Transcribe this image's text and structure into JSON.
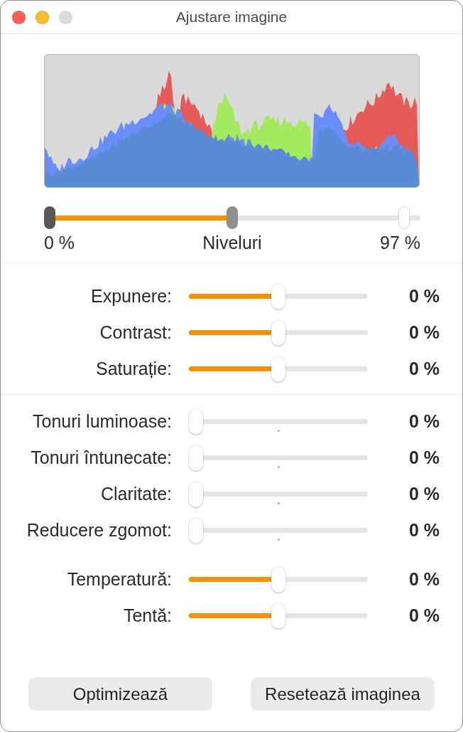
{
  "window": {
    "title": "Ajustare imagine",
    "controls": [
      {
        "kind": "close",
        "disabled": false
      },
      {
        "kind": "minimize",
        "disabled": false
      },
      {
        "kind": "zoom",
        "disabled": true
      }
    ]
  },
  "histogram": {
    "channels": [
      {
        "color": "#e55b57"
      },
      {
        "color": "#a3ea5e"
      },
      {
        "color": "#6a8df6"
      },
      {
        "color": "#5a8bd6"
      }
    ]
  },
  "levels": {
    "handles": [
      {
        "kind": "low",
        "level": 0
      },
      {
        "kind": "mid",
        "level": 0.5
      },
      {
        "kind": "high",
        "level": 0.97
      }
    ],
    "min_reading": "0 %",
    "label": "Niveluri",
    "max_reading": "97 %"
  },
  "sections": [
    {
      "groups": [
        {
          "sliders": [
            {
              "label": "Expunere:",
              "kind": "plain",
              "level": 0.5,
              "reading": "0 %"
            },
            {
              "label": "Contrast:",
              "kind": "plain",
              "level": 0.5,
              "reading": "0 %"
            },
            {
              "label": "Saturație:",
              "kind": "plain",
              "level": 0.5,
              "reading": "0 %"
            }
          ]
        }
      ]
    },
    {
      "groups": [
        {
          "sliders": [
            {
              "label": "Tonuri luminoase:",
              "kind": "marked",
              "level": 0,
              "reading": "0 %"
            },
            {
              "label": "Tonuri întunecate:",
              "kind": "marked",
              "level": 0,
              "reading": "0 %"
            },
            {
              "label": "Claritate:",
              "kind": "marked",
              "level": 0,
              "reading": "0 %"
            },
            {
              "label": "Reducere zgomot:",
              "kind": "marked",
              "level": 0,
              "reading": "0 %"
            }
          ]
        },
        {
          "sliders": [
            {
              "label": "Temperatură:",
              "kind": "plain",
              "level": 0.5,
              "reading": "0 %"
            },
            {
              "label": "Tentă:",
              "kind": "plain",
              "level": 0.5,
              "reading": "0 %"
            }
          ]
        }
      ]
    }
  ],
  "buttons": [
    "Optimizează",
    "Resetează imaginea"
  ]
}
